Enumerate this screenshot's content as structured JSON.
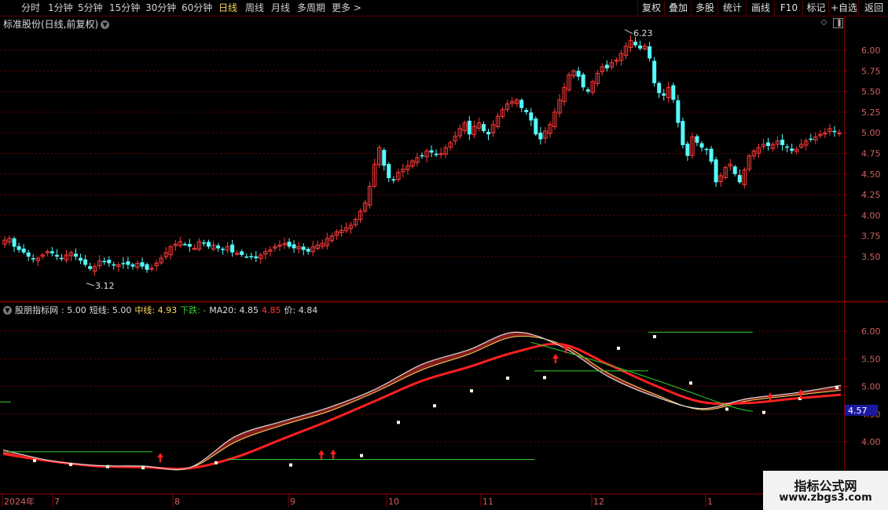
{
  "toolbar": {
    "periods": [
      {
        "label": "分时",
        "active": false
      },
      {
        "label": "1分钟",
        "active": false
      },
      {
        "label": "5分钟",
        "active": false
      },
      {
        "label": "15分钟",
        "active": false
      },
      {
        "label": "30分钟",
        "active": false
      },
      {
        "label": "60分钟",
        "active": false
      },
      {
        "label": "日线",
        "active": true
      },
      {
        "label": "周线",
        "active": false
      },
      {
        "label": "月线",
        "active": false
      },
      {
        "label": "多周期",
        "active": false
      },
      {
        "label": "更多 >",
        "active": false
      }
    ],
    "right_buttons": [
      "复权",
      "叠加",
      "多股",
      "统计",
      "画线",
      "F10",
      "标记",
      "+自选",
      "返回"
    ]
  },
  "main_chart": {
    "title": "标准股份(日线,前复权)",
    "y_ticks": [
      "6.00",
      "5.75",
      "5.50",
      "5.25",
      "5.00",
      "4.75",
      "4.50",
      "4.25",
      "4.00",
      "3.75",
      "3.50"
    ],
    "high_label": "6.23",
    "low_label": "3.12"
  },
  "indicator": {
    "name": "股朋指标网",
    "value": ": 5.00",
    "short_label": "短线: 5.00",
    "mid_label": "中线: 4.93",
    "down_label": "下跌: -",
    "ma20_label": "MA20: 4.85",
    "extra_value": "4.85",
    "price_label": "价: 4.84",
    "y_ticks": [
      "6.00",
      "5.50",
      "5.00",
      "4.50",
      "4.00"
    ],
    "current_value_tag": "4.57"
  },
  "time_axis": [
    "2024年",
    "7",
    "8",
    "9",
    "10",
    "11",
    "12",
    "1"
  ],
  "watermark": {
    "line1": "指标公式网",
    "line2": "www.zbgs3.com"
  },
  "colors": {
    "up": "#ff3a3a",
    "down": "#54ffff",
    "ma20": "#ff2020",
    "short": "#d8d8d8",
    "green": "#2fd02f",
    "fill": "#8a1e1e",
    "yellow": "#ffd75a"
  },
  "chart_data": {
    "type": "candlestick",
    "x_start": "2024-06",
    "x_end": "2025-01",
    "ylim": [
      3.3,
      6.3
    ],
    "high": 6.23,
    "low": 3.12,
    "closes": [
      3.7,
      3.72,
      3.62,
      3.58,
      3.55,
      3.5,
      3.47,
      3.48,
      3.52,
      3.56,
      3.54,
      3.5,
      3.48,
      3.52,
      3.55,
      3.5,
      3.45,
      3.4,
      3.35,
      3.38,
      3.45,
      3.44,
      3.42,
      3.4,
      3.4,
      3.42,
      3.4,
      3.38,
      3.42,
      3.38,
      3.34,
      3.36,
      3.42,
      3.48,
      3.55,
      3.62,
      3.65,
      3.68,
      3.65,
      3.62,
      3.6,
      3.68,
      3.66,
      3.62,
      3.64,
      3.6,
      3.58,
      3.62,
      3.55,
      3.54,
      3.52,
      3.5,
      3.5,
      3.48,
      3.52,
      3.56,
      3.58,
      3.62,
      3.64,
      3.66,
      3.62,
      3.6,
      3.62,
      3.58,
      3.56,
      3.62,
      3.64,
      3.66,
      3.72,
      3.75,
      3.8,
      3.82,
      3.85,
      3.88,
      3.95,
      4.05,
      4.15,
      4.35,
      4.62,
      4.82,
      4.6,
      4.45,
      4.42,
      4.52,
      4.56,
      4.6,
      4.66,
      4.7,
      4.72,
      4.78,
      4.76,
      4.73,
      4.75,
      4.82,
      4.88,
      4.96,
      5.05,
      5.12,
      4.98,
      5.08,
      5.12,
      5.02,
      4.98,
      5.1,
      5.2,
      5.28,
      5.35,
      5.38,
      5.4,
      5.3,
      5.25,
      5.15,
      4.98,
      4.92,
      5.02,
      5.1,
      5.25,
      5.4,
      5.55,
      5.7,
      5.75,
      5.68,
      5.55,
      5.5,
      5.62,
      5.72,
      5.8,
      5.78,
      5.85,
      5.88,
      5.96,
      6.05,
      6.12,
      6.06,
      6.02,
      6.05,
      5.9,
      5.6,
      5.48,
      5.45,
      5.55,
      5.4,
      5.12,
      4.85,
      4.72,
      4.95,
      4.88,
      4.82,
      4.8,
      4.65,
      4.4,
      4.48,
      4.58,
      4.62,
      4.5,
      4.4,
      4.55,
      4.72,
      4.78,
      4.82,
      4.86,
      4.84,
      4.86,
      4.9,
      4.85,
      4.82,
      4.78,
      4.8,
      4.86,
      4.9,
      4.92,
      4.95,
      4.98,
      5.0,
      5.05,
      5.02,
      5.0
    ],
    "series": [
      {
        "name": "短线",
        "values": [
          3.85,
          3.66,
          3.57,
          3.56,
          3.53,
          4.1,
          4.37,
          4.62,
          4.95,
          5.4,
          5.66,
          5.98,
          5.72,
          5.18,
          4.82,
          4.6,
          4.78,
          4.88,
          5.02
        ]
      },
      {
        "name": "中线",
        "values": [
          3.8,
          3.65,
          3.56,
          3.55,
          3.52,
          4.0,
          4.3,
          4.55,
          4.9,
          5.3,
          5.58,
          5.9,
          5.76,
          5.24,
          4.86,
          4.58,
          4.74,
          4.84,
          4.93
        ]
      },
      {
        "name": "MA20",
        "values": [
          3.78,
          3.65,
          3.56,
          3.54,
          3.52,
          3.72,
          4.05,
          4.38,
          4.74,
          5.1,
          5.35,
          5.62,
          5.76,
          5.4,
          5.02,
          4.72,
          4.7,
          4.78,
          4.85
        ]
      }
    ]
  }
}
